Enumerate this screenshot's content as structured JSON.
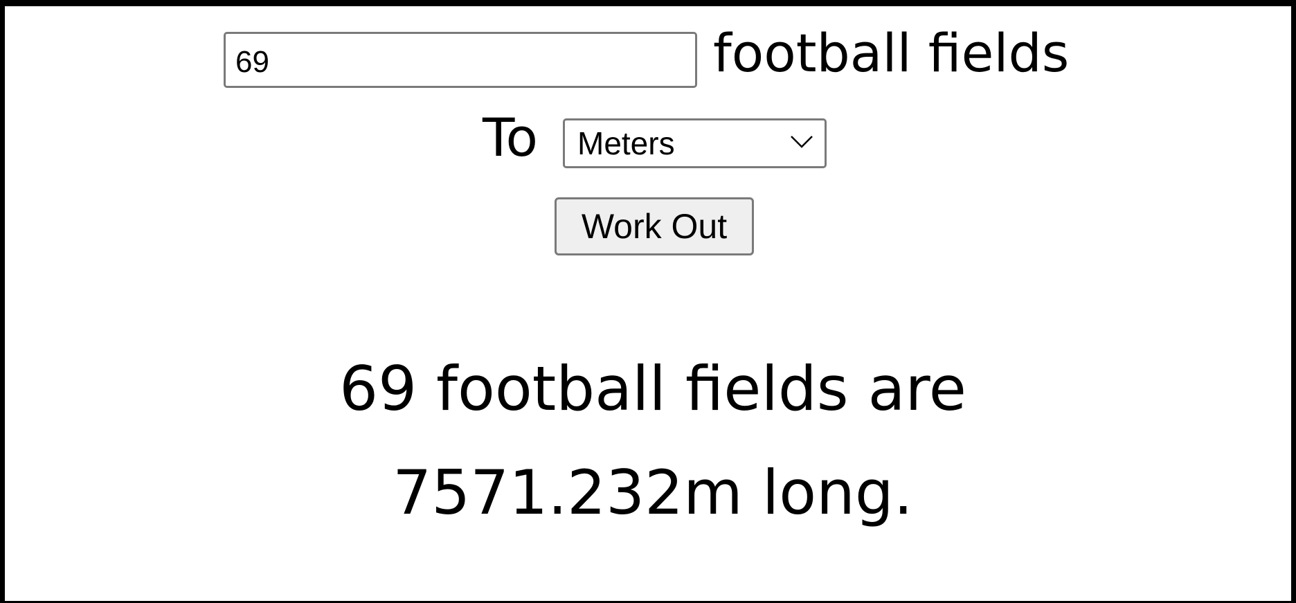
{
  "converter": {
    "quantity_value": "69",
    "from_unit_label": "football fields",
    "to_label": "To",
    "to_unit_selected": "Meters",
    "submit_label": "Work Out"
  },
  "result": {
    "line1": "69 football fields are",
    "line2": "7571.232m long."
  },
  "icons": {
    "select_arrow": "chevron-down-icon"
  }
}
